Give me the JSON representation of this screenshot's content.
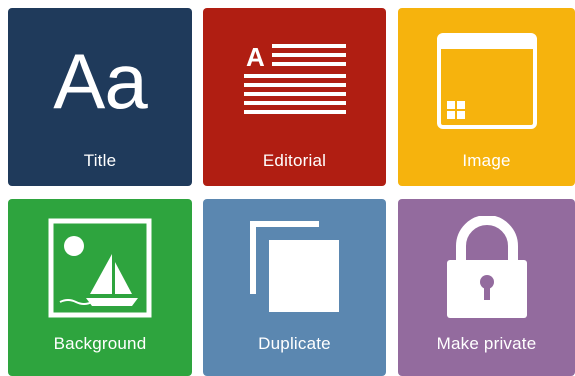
{
  "tiles": {
    "title": {
      "label": "Title",
      "icon": "text-format-icon",
      "glyph": "Aa",
      "color": "#1f3a5b"
    },
    "editorial": {
      "label": "Editorial",
      "icon": "article-icon",
      "glyph": "A",
      "color": "#b01e12"
    },
    "image": {
      "label": "Image",
      "icon": "image-layout-icon",
      "color": "#f6b30d"
    },
    "background": {
      "label": "Background",
      "icon": "landscape-photo-icon",
      "color": "#2ea43e"
    },
    "duplicate": {
      "label": "Duplicate",
      "icon": "duplicate-icon",
      "color": "#5b87b0"
    },
    "private": {
      "label": "Make private",
      "icon": "padlock-icon",
      "color": "#936b9e"
    }
  }
}
